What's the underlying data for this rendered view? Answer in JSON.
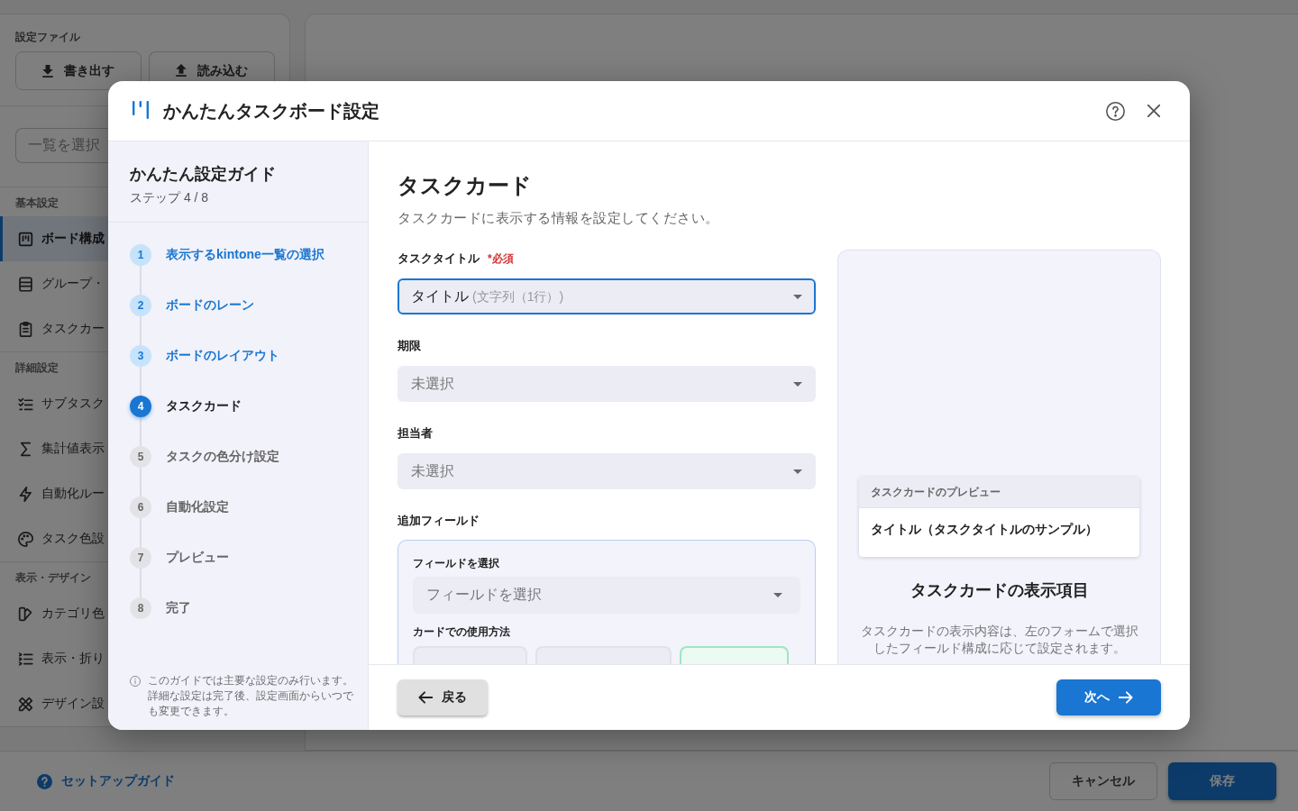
{
  "background": {
    "sidebar": {
      "settings_file": {
        "label": "設定ファイル",
        "buttons": [
          {
            "label": "書き出す",
            "kind": "export"
          },
          {
            "label": "読み込む",
            "kind": "import"
          }
        ]
      },
      "list_select": {
        "placeholder": "一覧を選択"
      },
      "sections": [
        {
          "title": "基本設定",
          "items": [
            {
              "label": "ボード構成",
              "kind": "board",
              "selected": true
            },
            {
              "label": "グループ・",
              "kind": "rows",
              "selected": false
            },
            {
              "label": "タスクカー",
              "kind": "clipboard",
              "selected": false
            }
          ]
        },
        {
          "title": "詳細設定",
          "items": [
            {
              "label": "サブタスク",
              "kind": "checklist",
              "selected": false
            },
            {
              "label": "集計値表示",
              "kind": "sigma",
              "selected": false
            },
            {
              "label": "自動化ルー",
              "kind": "bolt",
              "selected": false
            },
            {
              "label": "タスク色設",
              "kind": "palette",
              "selected": false
            }
          ]
        },
        {
          "title": "表示・デザイン",
          "items": [
            {
              "label": "カテゴリ色",
              "kind": "category",
              "selected": false
            },
            {
              "label": "表示・折り",
              "kind": "list",
              "selected": false
            },
            {
              "label": "デザイン設",
              "kind": "tools",
              "selected": false
            }
          ]
        }
      ]
    },
    "footer": {
      "guide_link": "セットアップガイド",
      "buttons": [
        {
          "label": "キャンセル",
          "kind": "secondary"
        },
        {
          "label": "保存",
          "kind": "primary"
        }
      ]
    }
  },
  "dialog": {
    "title": "かんたんタスクボード設定",
    "guide": {
      "title": "かんたん設定ガイド",
      "step_counter": "ステップ 4 / 8",
      "steps": [
        {
          "number": "1",
          "label": "表示するkintone一覧の選択",
          "completed": true,
          "selected": false
        },
        {
          "number": "2",
          "label": "ボードのレーン",
          "completed": true,
          "selected": false
        },
        {
          "number": "3",
          "label": "ボードのレイアウト",
          "completed": true,
          "selected": false
        },
        {
          "number": "4",
          "label": "タスクカード",
          "completed": false,
          "selected": true
        },
        {
          "number": "5",
          "label": "タスクの色分け設定",
          "completed": false,
          "selected": false
        },
        {
          "number": "6",
          "label": "自動化設定",
          "completed": false,
          "selected": false
        },
        {
          "number": "7",
          "label": "プレビュー",
          "completed": false,
          "selected": false
        },
        {
          "number": "8",
          "label": "完了",
          "completed": false,
          "selected": false
        }
      ],
      "note": "このガイドでは主要な設定のみ行います。詳細な設定は完了後、設定画面からいつでも変更できます。"
    },
    "content": {
      "title": "タスクカード",
      "description": "タスクカードに表示する情報を設定してください。",
      "fields": [
        {
          "label": "タスクタイトル",
          "required_mark": "*必須",
          "value": "タイトル",
          "value_hint": "(文字列（1行）)",
          "focused": true
        },
        {
          "label": "期限",
          "placeholder": "未選択",
          "focused": false
        },
        {
          "label": "担当者",
          "placeholder": "未選択",
          "focused": false
        }
      ],
      "additional_fields": {
        "label": "追加フィールド",
        "field_select": {
          "label": "フィールドを選択",
          "placeholder": "フィールドを選択"
        },
        "usage": {
          "label": "カードでの使用方法",
          "options": [
            {
              "selected": false
            },
            {
              "selected": false
            },
            {
              "selected": true
            }
          ]
        }
      },
      "preview": {
        "card_header": "タスクカードのプレビュー",
        "card_title": "タイトル（タスクタイトルのサンプル）",
        "heading": "タスクカードの表示項目",
        "description": "タスクカードの表示内容は、左のフォームで選択したフィールド構成に応じて設定されます。"
      }
    },
    "footer": {
      "buttons": [
        {
          "label": "戻る",
          "kind": "back"
        },
        {
          "label": "次へ",
          "kind": "next"
        }
      ]
    }
  }
}
